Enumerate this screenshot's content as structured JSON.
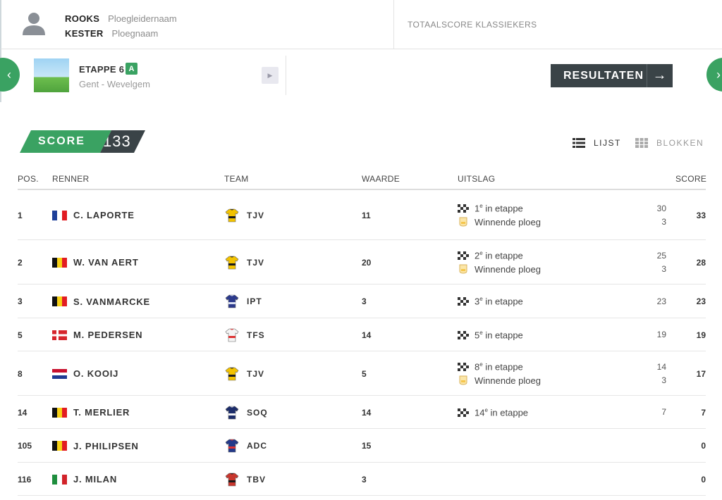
{
  "header": {
    "leader_name": "ROOKS",
    "leader_label": "Ploegleidernaam",
    "team_name": "KESTER",
    "team_label": "Ploegnaam",
    "total_label": "TOTAALSCORE KLASSIEKERS"
  },
  "stage": {
    "title": "ETAPPE 6",
    "badge": "A",
    "route": "Gent - Wevelgem",
    "results_label": "RESULTATEN"
  },
  "score": {
    "label": "SCORE",
    "value": "133"
  },
  "view": {
    "list_label": "LIJST",
    "blocks_label": "BLOKKEN"
  },
  "table": {
    "headers": {
      "pos": "POS.",
      "renner": "RENNER",
      "team": "TEAM",
      "waarde": "WAARDE",
      "uitslag": "UITSLAG",
      "score": "SCORE"
    },
    "rows": [
      {
        "pos": "1",
        "flag": "fr",
        "name": "C. LAPORTE",
        "jersey": "tjv",
        "team": "TJV",
        "waarde": "11",
        "results": [
          {
            "icon": "finish-flag-icon",
            "pre": "1",
            "sup": "e",
            "post": " in etappe",
            "pts": "30"
          },
          {
            "icon": "winning-team-icon",
            "pre": "Winnende ploeg",
            "sup": "",
            "post": "",
            "pts": "3"
          }
        ],
        "score": "33"
      },
      {
        "pos": "2",
        "flag": "be",
        "name": "W. VAN AERT",
        "jersey": "tjv",
        "team": "TJV",
        "waarde": "20",
        "results": [
          {
            "icon": "finish-flag-icon",
            "pre": "2",
            "sup": "e",
            "post": " in etappe",
            "pts": "25"
          },
          {
            "icon": "winning-team-icon",
            "pre": "Winnende ploeg",
            "sup": "",
            "post": "",
            "pts": "3"
          }
        ],
        "score": "28"
      },
      {
        "pos": "3",
        "flag": "be",
        "name": "S. VANMARCKE",
        "jersey": "ipt",
        "team": "IPT",
        "waarde": "3",
        "results": [
          {
            "icon": "finish-flag-icon",
            "pre": "3",
            "sup": "e",
            "post": " in etappe",
            "pts": "23"
          }
        ],
        "score": "23"
      },
      {
        "pos": "5",
        "flag": "dk",
        "name": "M. PEDERSEN",
        "jersey": "tfs",
        "team": "TFS",
        "waarde": "14",
        "results": [
          {
            "icon": "finish-flag-icon",
            "pre": "5",
            "sup": "e",
            "post": " in etappe",
            "pts": "19"
          }
        ],
        "score": "19"
      },
      {
        "pos": "8",
        "flag": "nl",
        "name": "O. KOOIJ",
        "jersey": "tjv",
        "team": "TJV",
        "waarde": "5",
        "results": [
          {
            "icon": "finish-flag-icon",
            "pre": "8",
            "sup": "e",
            "post": " in etappe",
            "pts": "14"
          },
          {
            "icon": "winning-team-icon",
            "pre": "Winnende ploeg",
            "sup": "",
            "post": "",
            "pts": "3"
          }
        ],
        "score": "17"
      },
      {
        "pos": "14",
        "flag": "be",
        "name": "T. MERLIER",
        "jersey": "soq",
        "team": "SOQ",
        "waarde": "14",
        "results": [
          {
            "icon": "finish-flag-icon",
            "pre": "14",
            "sup": "e",
            "post": " in etappe",
            "pts": "7"
          }
        ],
        "score": "7"
      },
      {
        "pos": "105",
        "flag": "be",
        "name": "J. PHILIPSEN",
        "jersey": "adc",
        "team": "ADC",
        "waarde": "15",
        "results": [],
        "score": "0"
      },
      {
        "pos": "116",
        "flag": "it",
        "name": "J. MILAN",
        "jersey": "tbv",
        "team": "TBV",
        "waarde": "3",
        "results": [],
        "score": "0"
      }
    ]
  }
}
